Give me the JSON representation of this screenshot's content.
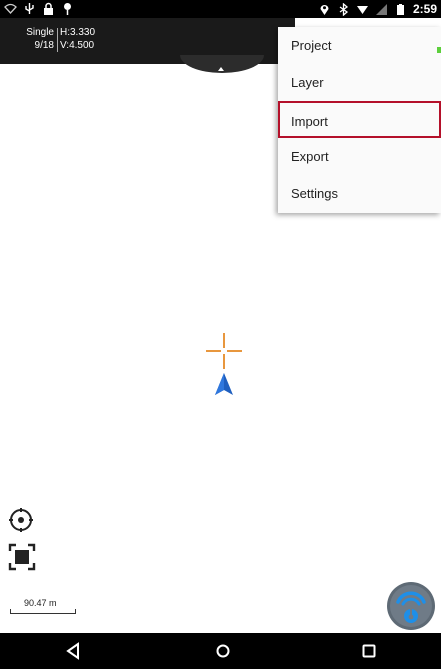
{
  "status_bar": {
    "time": "2:59",
    "icons_left": [
      "wifi-icon",
      "usb-icon",
      "lock-icon",
      "location-pin-icon"
    ],
    "icons_right": [
      "location-icon",
      "bluetooth-icon",
      "signal-icon",
      "no-sim-icon",
      "battery-icon"
    ]
  },
  "gps_panel": {
    "mode": "Single",
    "satellites": "9/18",
    "h_precision": "H:3.330",
    "v_precision": "V:4.500"
  },
  "menu": {
    "items": [
      {
        "label": "Project"
      },
      {
        "label": "Layer"
      },
      {
        "label": "Import",
        "highlighted": true
      },
      {
        "label": "Export"
      },
      {
        "label": "Settings"
      }
    ],
    "highlight_color": "#b4102a"
  },
  "map": {
    "crosshair_color": "#e8973e",
    "arrow_color": "#1f5fbf",
    "scale_label": "90.47 m"
  },
  "nav_bar": {
    "buttons": [
      "back-icon",
      "home-icon",
      "recents-icon"
    ]
  }
}
